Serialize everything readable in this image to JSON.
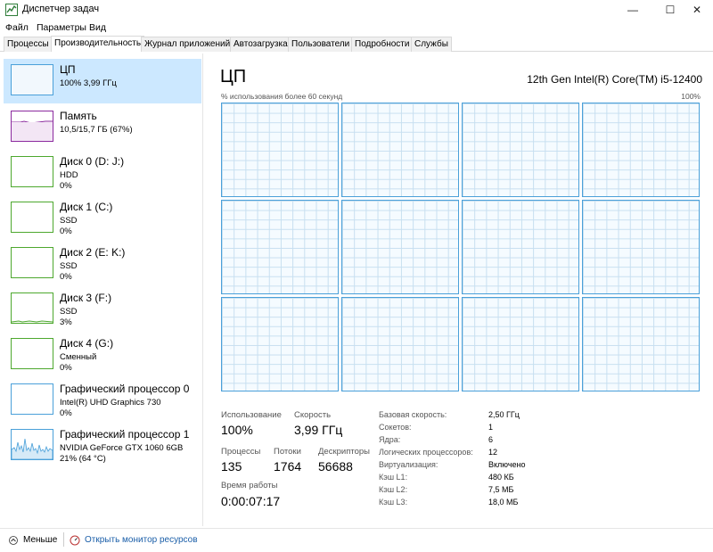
{
  "window": {
    "title": "Диспетчер задач",
    "controls": {
      "minimize": "—",
      "maximize": "☐",
      "close": "✕"
    }
  },
  "menu": [
    "Файл",
    "Параметры",
    "Вид"
  ],
  "tabs": [
    "Процессы",
    "Производительность",
    "Журнал приложений",
    "Автозагрузка",
    "Пользователи",
    "Подробности",
    "Службы"
  ],
  "active_tab": "Производительность",
  "sidebar": {
    "items": [
      {
        "name": "ЦП",
        "line1": "100% 3,99 ГГц",
        "line2": "",
        "color": "#4aa0d9",
        "active": true
      },
      {
        "name": "Память",
        "line1": "10,5/15,7 ГБ (67%)",
        "line2": "",
        "color": "#8b2a9e"
      },
      {
        "name": "Диск 0 (D: J:)",
        "line1": "HDD",
        "line2": "0%",
        "color": "#4da82e"
      },
      {
        "name": "Диск 1 (C:)",
        "line1": "SSD",
        "line2": "0%",
        "color": "#4da82e"
      },
      {
        "name": "Диск 2 (E: K:)",
        "line1": "SSD",
        "line2": "0%",
        "color": "#4da82e"
      },
      {
        "name": "Диск 3 (F:)",
        "line1": "SSD",
        "line2": "3%",
        "color": "#4da82e"
      },
      {
        "name": "Диск 4 (G:)",
        "line1": "Сменный",
        "line2": "0%",
        "color": "#4da82e"
      },
      {
        "name": "Графический процессор 0",
        "line1": "Intel(R) UHD Graphics 730",
        "line2": "0%",
        "color": "#4aa0d9"
      },
      {
        "name": "Графический процессор 1",
        "line1": "NVIDIA GeForce GTX 1060 6GB",
        "line2": "21% (64 °C)",
        "color": "#4aa0d9"
      }
    ]
  },
  "main": {
    "title": "ЦП",
    "cpu_model": "12th Gen Intel(R) Core(TM) i5-12400",
    "graph_label": "% использования более 60 секунд",
    "graph_max": "100%",
    "logical_processors_graphs": 12
  },
  "stats": {
    "usage_label": "Использование",
    "usage_value": "100%",
    "speed_label": "Скорость",
    "speed_value": "3,99 ГГц",
    "processes_label": "Процессы",
    "processes_value": "135",
    "threads_label": "Потоки",
    "threads_value": "1764",
    "handles_label": "Дескрипторы",
    "handles_value": "56688",
    "uptime_label": "Время работы",
    "uptime_value": "0:00:07:17"
  },
  "specs": [
    {
      "label": "Базовая скорость:",
      "value": "2,50 ГГц"
    },
    {
      "label": "Сокетов:",
      "value": "1"
    },
    {
      "label": "Ядра:",
      "value": "6"
    },
    {
      "label": "Логических процессоров:",
      "value": "12"
    },
    {
      "label": "Виртуализация:",
      "value": "Включено"
    },
    {
      "label": "Кэш L1:",
      "value": "480 КБ"
    },
    {
      "label": "Кэш L2:",
      "value": "7,5 МБ"
    },
    {
      "label": "Кэш L3:",
      "value": "18,0 МБ"
    }
  ],
  "footer": {
    "less_label": "Меньше",
    "monitor_link": "Открыть монитор ресурсов"
  },
  "colors": {
    "accent": "#4aa0d9",
    "selected_bg": "#cce8ff",
    "link": "#1a5ea8"
  }
}
